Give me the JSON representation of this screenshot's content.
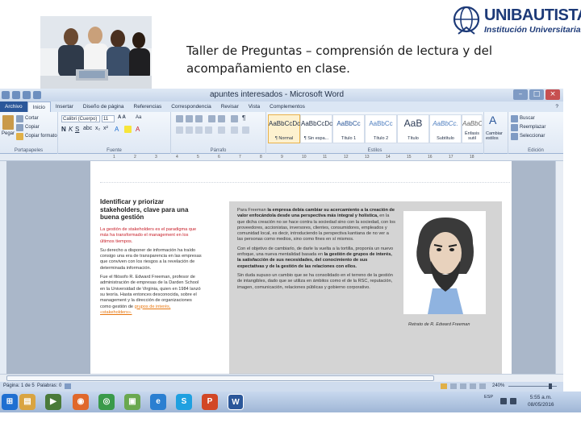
{
  "slide": {
    "title": "Taller de Preguntas – comprensión de lectura y del acompañamiento en clase.",
    "logo": {
      "name": "UNIBAUTISTA",
      "subtitle": "Institución Universitaria"
    }
  },
  "word": {
    "window_title": "apuntes interesados - Microsoft Word",
    "tabs": [
      {
        "label": "Archivo",
        "active": false
      },
      {
        "label": "Inicio",
        "active": true
      },
      {
        "label": "Insertar",
        "active": false
      },
      {
        "label": "Diseño de página",
        "active": false
      },
      {
        "label": "Referencias",
        "active": false
      },
      {
        "label": "Correspondencia",
        "active": false
      },
      {
        "label": "Revisar",
        "active": false
      },
      {
        "label": "Vista",
        "active": false
      },
      {
        "label": "Complementos",
        "active": false
      }
    ],
    "clipboard": {
      "paste_label": "Pegar",
      "cut_label": "Cortar",
      "copy_label": "Copiar",
      "format_painter_label": "Copiar formato",
      "group_label": "Portapapeles"
    },
    "font": {
      "name": "Calibri (Cuerpo)",
      "size": "11",
      "group_label": "Fuente"
    },
    "paragraph": {
      "group_label": "Párrafo"
    },
    "styles": {
      "group_label": "Estilos",
      "items": [
        {
          "preview": "AaBbCcDc",
          "name": "¶ Normal",
          "selected": true
        },
        {
          "preview": "AaBbCcDc",
          "name": "¶ Sin espa...",
          "selected": false
        },
        {
          "preview": "AaBbCc",
          "name": "Título 1",
          "selected": false
        },
        {
          "preview": "AaBbCc",
          "name": "Título 2",
          "selected": false
        },
        {
          "preview": "AaB",
          "name": "Título",
          "selected": false
        },
        {
          "preview": "AaBbCc.",
          "name": "Subtítulo",
          "selected": false
        },
        {
          "preview": "AaBbCcDc",
          "name": "Énfasis sutil",
          "selected": false
        }
      ],
      "change_styles_label": "Cambiar estilos"
    },
    "editing": {
      "group_label": "Edición",
      "find_label": "Buscar",
      "replace_label": "Reemplazar",
      "select_label": "Seleccionar"
    },
    "ruler_numbers": [
      "1",
      "2",
      "3",
      "4",
      "5",
      "6",
      "7",
      "8",
      "9",
      "10",
      "11",
      "12",
      "13",
      "14",
      "15",
      "16",
      "17",
      "18"
    ],
    "document": {
      "article_title": "Identificar y priorizar stakeholders, clave para una buena gestión",
      "left_red": "La gestión de stakeholders es el paradigma que más ha transformado el management en los últimos tiempos.",
      "left_p2": "Su derecho a disponer de información ha traído consigo una era de transparencia en las empresas que conviven con los riesgos a la revelación de determinada información.",
      "left_p3": "Fue el filósofo R. Edward Freeman, profesor de administración de empresas de la Darden School en la Universidad de Virginia, quien en 1984 lanzó su teoría. Hasta entonces desconocida, sobre el management y la dirección de organizaciones como gestión de",
      "left_link": "grupos de interés, «stakeholders».",
      "mid_p1_start": "Para Freeman",
      "mid_p1_bold": "la empresa debía cambiar su acercamiento a la creación de valor enfocándola desde una perspectiva más integral y holística,",
      "mid_p1_end": "en la que dicha creación no se hace contra la sociedad sino con la sociedad, con los proveedores, accionistas, inversores, clientes, consumidores, empleados y comunidad local, es decir, introduciendo la perspectiva kantiana de no ver a las personas como medios, sino como fines en sí mismos.",
      "mid_p2_start": "Con el objetivo de cambiarlo, de darle la vuelta a la tortilla, proponía un nuevo enfoque, una nueva mentalidad basada en",
      "mid_p2_bold": "la gestión de grupos de interés, la satisfacción de sus necesidades, del conocimiento de sus expectativas y de la gestión de las relaciones con ellos.",
      "mid_p3": "Sin duda supuso un cambio que se ha consolidado en el terreno de la gestión de intangibles, dado que se utiliza en ámbitos como el de la RSC, reputación, imagen, comunicación, relaciones públicas y gobierno corporativo.",
      "caption": "Retrato de R. Edward Freeman"
    },
    "status": {
      "page": "Página: 1 de 5",
      "words": "Palabras: 0",
      "zoom": "240%"
    }
  },
  "taskbar": {
    "apps": [
      {
        "name": "start",
        "color": "#1f6fd1",
        "glyph": "⊞"
      },
      {
        "name": "explorer",
        "color": "#d9a441",
        "glyph": "▤"
      },
      {
        "name": "media",
        "color": "#4a7a3a",
        "glyph": "▶"
      },
      {
        "name": "firefox",
        "color": "#e0682b",
        "glyph": "◉"
      },
      {
        "name": "chrome",
        "color": "#3a9a4a",
        "glyph": "◎"
      },
      {
        "name": "photos",
        "color": "#6aa84f",
        "glyph": "▣"
      },
      {
        "name": "ie",
        "color": "#2b7fd1",
        "glyph": "e"
      },
      {
        "name": "skype",
        "color": "#1fa0e0",
        "glyph": "S"
      },
      {
        "name": "powerpoint",
        "color": "#d24726",
        "glyph": "P"
      },
      {
        "name": "word",
        "color": "#2b579a",
        "glyph": "W"
      }
    ],
    "tray": "ESP",
    "time": "5:55 a.m.",
    "date": "08/05/2016"
  }
}
